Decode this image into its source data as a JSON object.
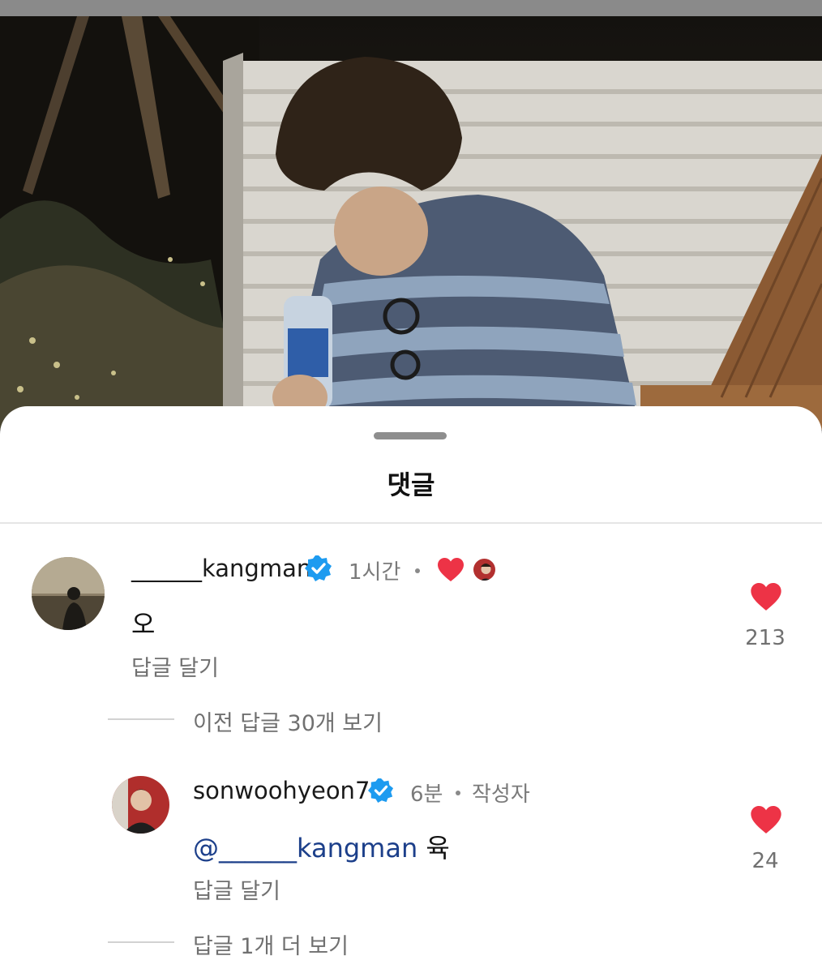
{
  "sheet": {
    "title": "댓글"
  },
  "comments": [
    {
      "username": "______kangman",
      "time": "1시간",
      "text": "오",
      "reply_label": "답글 달기",
      "like_count": "213",
      "view_previous_replies": "이전 답글 30개 보기"
    }
  ],
  "replies": [
    {
      "username": "sonwoohyeon7",
      "time": "6분",
      "author_badge": "작성자",
      "mention": "@______kangman",
      "text": "육",
      "reply_label": "답글 달기",
      "like_count": "24",
      "view_more_replies": "답글 1개 더 보기"
    }
  ],
  "colors": {
    "heart": "#ed3346",
    "verified": "#1d9bf0",
    "mention": "#1c3f8a"
  },
  "icons": [
    "verified-badge-icon",
    "heart-icon",
    "liked-by-author-heart-icon",
    "author-avatar-mini-icon"
  ]
}
